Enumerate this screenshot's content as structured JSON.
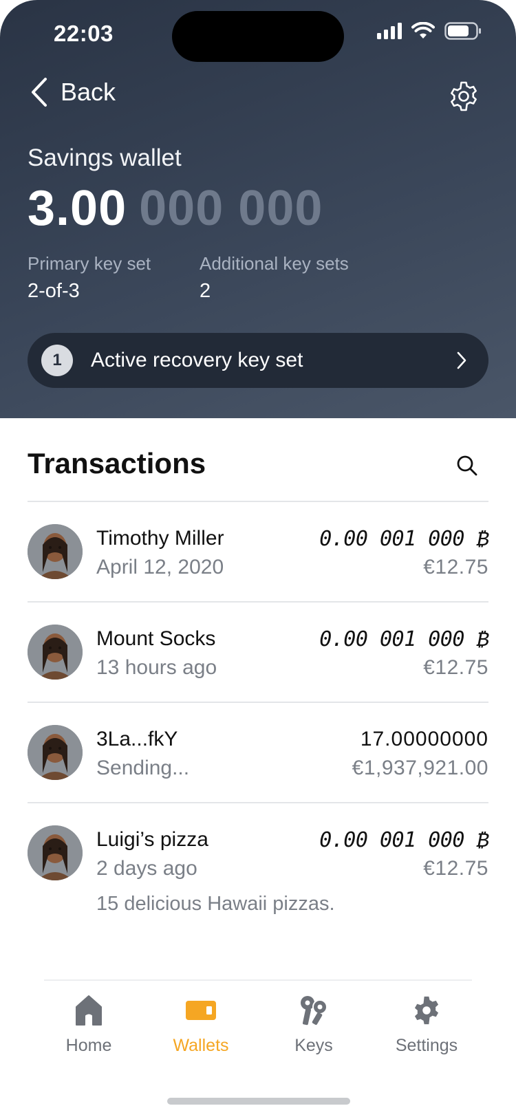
{
  "status_bar": {
    "time": "22:03"
  },
  "nav": {
    "back_label": "Back"
  },
  "wallet": {
    "name": "Savings wallet",
    "balance_main": "3.00",
    "balance_dim": "000 000",
    "primary_label": "Primary key set",
    "primary_value": "2-of-3",
    "additional_label": "Additional key sets",
    "additional_value": "2",
    "recovery_count": "1",
    "recovery_label": "Active recovery key set"
  },
  "transactions": {
    "title": "Transactions",
    "items": [
      {
        "name": "Timothy Miller",
        "sub": "April 12, 2020",
        "amount": "0.00 001 000 ₿",
        "fiat": "€12.75"
      },
      {
        "name": "Mount Socks",
        "sub": "13 hours ago",
        "amount": "0.00 001 000 ₿",
        "fiat": "€12.75"
      },
      {
        "name": "3La...fkY",
        "sub": "Sending...",
        "amount": "17.00000000",
        "fiat": "€1,937,921.00"
      },
      {
        "name": "Luigi’s pizza",
        "sub": "2 days ago",
        "amount": "0.00 001 000 ₿",
        "fiat": "€12.75",
        "note": "15 delicious Hawaii pizzas."
      }
    ]
  },
  "tabbar": {
    "items": [
      {
        "label": "Home",
        "icon": "home-icon"
      },
      {
        "label": "Wallets",
        "icon": "wallet-icon",
        "active": true
      },
      {
        "label": "Keys",
        "icon": "keys-icon"
      },
      {
        "label": "Settings",
        "icon": "settings-icon"
      }
    ],
    "active_color": "#f5a623",
    "inactive_color": "#6d7178"
  },
  "colors": {
    "header_dark": "#2a3445",
    "header_light": "#4a5668",
    "accent": "#f5a623"
  }
}
